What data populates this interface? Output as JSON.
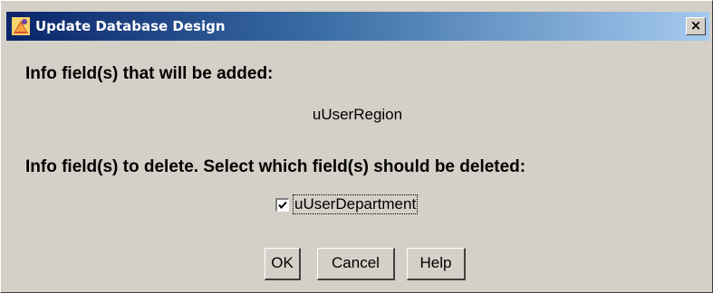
{
  "window": {
    "title": "Update Database Design",
    "close_label": "×"
  },
  "added": {
    "heading": "Info field(s) that will be added:",
    "fields": [
      "uUserRegion"
    ]
  },
  "delete": {
    "heading": "Info field(s) to delete. Select which field(s) should be deleted:",
    "fields": [
      {
        "label": "uUserDepartment",
        "checked": true
      }
    ]
  },
  "buttons": {
    "ok": "OK",
    "cancel": "Cancel",
    "help": "Help"
  },
  "colors": {
    "dialog_bg": "#d4d0c8",
    "titlebar_start": "#0a246a",
    "titlebar_end": "#a6caf0"
  },
  "icons": {
    "title_icon": "app-icon",
    "close_icon": "close-icon",
    "checkbox_mark": "checkmark-icon"
  }
}
